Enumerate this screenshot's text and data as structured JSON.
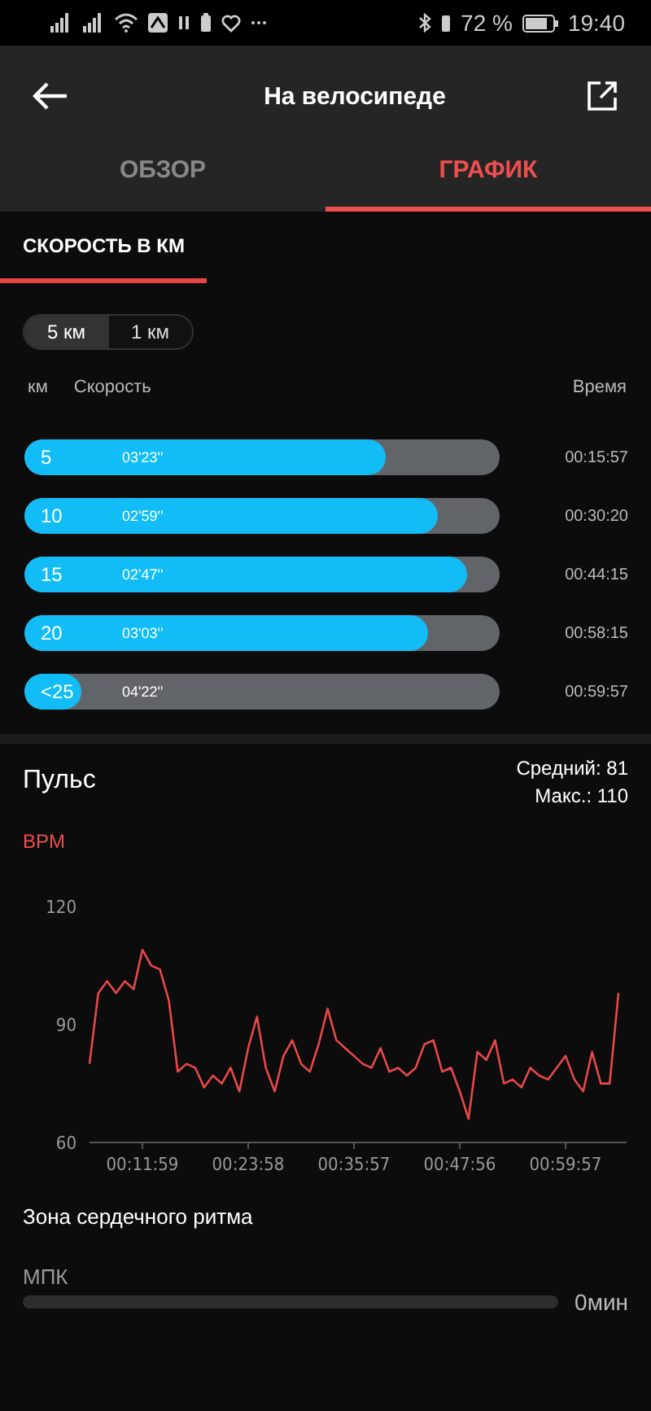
{
  "status_bar": {
    "battery": "72 %",
    "time": "19:40"
  },
  "header": {
    "title": "На велосипеде"
  },
  "tabs": [
    {
      "label": "ОБЗОР",
      "selected": false
    },
    {
      "label": "ГРАФИК",
      "selected": true
    }
  ],
  "subtabs": [
    {
      "label": "СКОРОСТЬ В КМ",
      "selected": true
    }
  ],
  "segments": [
    {
      "label": "5 км",
      "selected": true
    },
    {
      "label": "1 км",
      "selected": false
    }
  ],
  "speed_table": {
    "columns": [
      "км",
      "Скорость",
      "Время"
    ],
    "rows": [
      {
        "km": "5",
        "pace": "03'23''",
        "time": "00:15:57",
        "level": 0.76
      },
      {
        "km": "10",
        "pace": "02'59''",
        "time": "00:30:20",
        "level": 0.87
      },
      {
        "km": "15",
        "pace": "02'47''",
        "time": "00:44:15",
        "level": 0.93
      },
      {
        "km": "20",
        "pace": "03'03''",
        "time": "00:58:15",
        "level": 0.85
      },
      {
        "km": "<25",
        "pace": "04'22''",
        "time": "00:59:57",
        "level": 0.12
      }
    ]
  },
  "pulse": {
    "title": "Пульс",
    "average": "Средний: 81",
    "max": "Макс.: 110",
    "chart_data": {
      "type": "line",
      "ylabel": "BPM",
      "ylim": [
        60,
        120
      ],
      "yticks": [
        60,
        90,
        120
      ],
      "categories": [
        null,
        null,
        null,
        null,
        null,
        null,
        "00:11:59",
        null,
        null,
        null,
        null,
        null,
        null,
        null,
        null,
        null,
        null,
        null,
        "00:23:58",
        null,
        null,
        null,
        null,
        null,
        null,
        null,
        null,
        null,
        null,
        null,
        "00:35:57",
        null,
        null,
        null,
        null,
        null,
        null,
        null,
        null,
        null,
        null,
        null,
        "00:47:56",
        null,
        null,
        null,
        null,
        null,
        null,
        null,
        null,
        null,
        null,
        null,
        "00:59:57",
        null,
        null,
        null,
        null,
        null,
        null
      ],
      "series": [
        {
          "color": "#e84848",
          "values": [
            80,
            98,
            101,
            98,
            101,
            99,
            109,
            105,
            104,
            96,
            78,
            80,
            79,
            74,
            77,
            75,
            79,
            73,
            84,
            92,
            79,
            73,
            82,
            86,
            80,
            78,
            85,
            94,
            86,
            84,
            82,
            80,
            79,
            84,
            78,
            79,
            77,
            79,
            85,
            86,
            78,
            79,
            73,
            66,
            83,
            81,
            86,
            75,
            76,
            74,
            79,
            77,
            76,
            79,
            82,
            76,
            73,
            83,
            75,
            75,
            98
          ]
        }
      ]
    }
  },
  "zones": {
    "title": "Зона сердечного ритма",
    "items": [
      {
        "label": "МПК",
        "value": "0мин"
      }
    ]
  }
}
